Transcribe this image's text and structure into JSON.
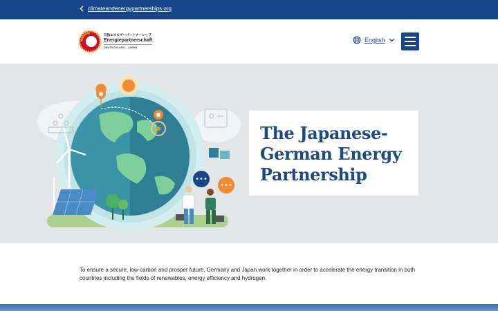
{
  "topbar": {
    "back_link": "climateandenergypartnerships.org"
  },
  "logo": {
    "jp": "日独エネルギーパートナーシップ",
    "name": "Energiepartnerschaft",
    "sub": "DEUTSCHLAND – JAPAN"
  },
  "header": {
    "language": "English"
  },
  "hero": {
    "title": "The Japanese-German Energy Partnership"
  },
  "intro": {
    "text": "To ensure a secure, low-carbon and prosper future, Germany and Japan work together in order to accelerate the energy transition in both countries including the fields of renewables, energy efficiency and hydrogen."
  },
  "colors": {
    "brand_blue": "#16458a",
    "title_blue": "#1f4a80",
    "hero_bg": "#e4e5e6"
  }
}
